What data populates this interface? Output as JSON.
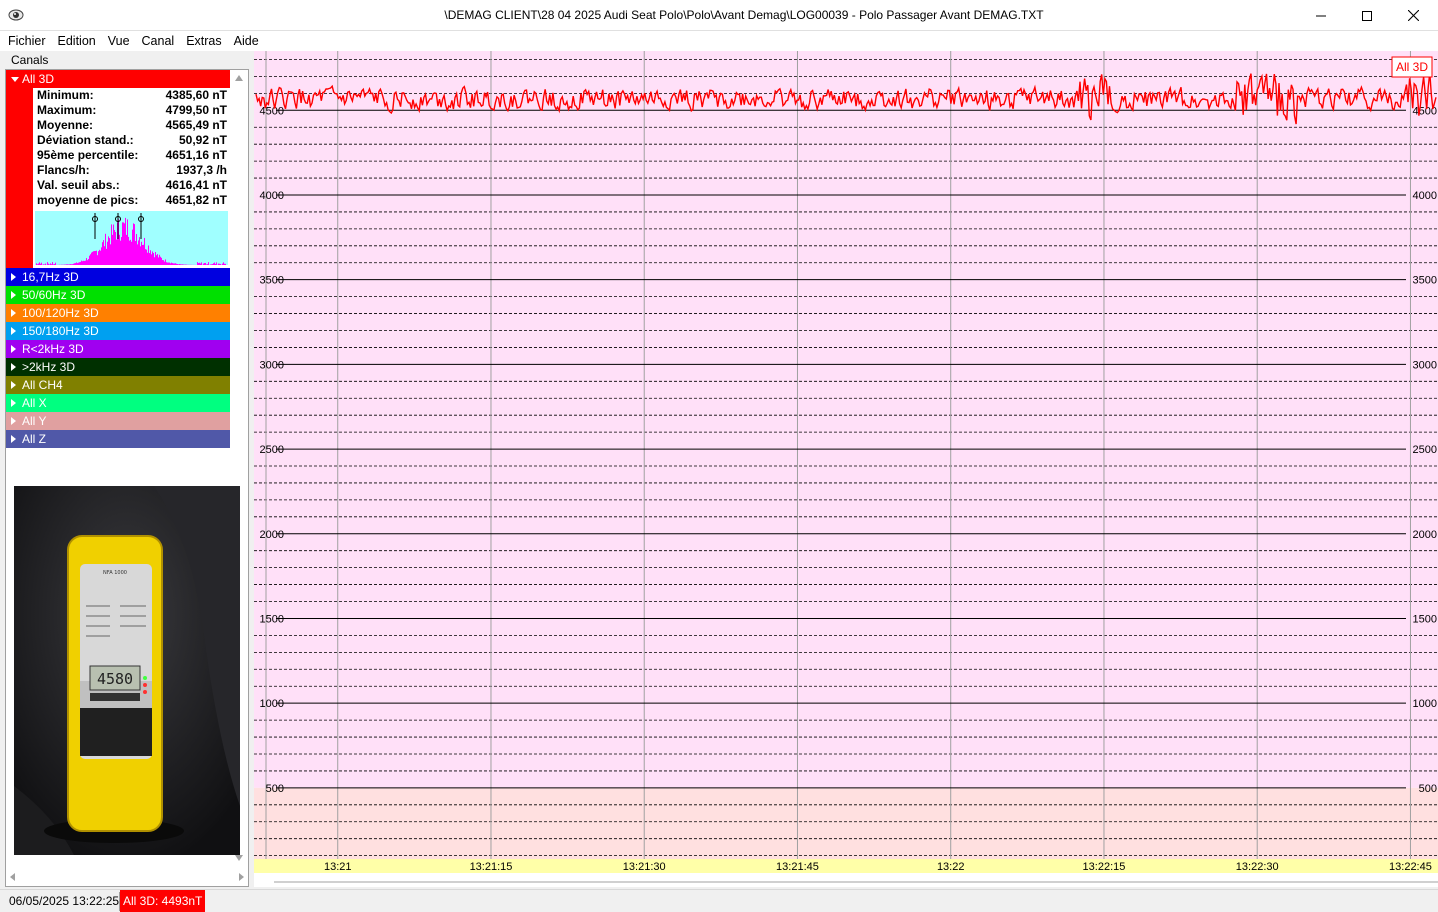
{
  "window": {
    "title": "\\DEMAG CLIENT\\28 04 2025 Audi Seat Polo\\Polo\\Avant Demag\\LOG00039 - Polo Passager Avant DEMAG.TXT"
  },
  "menu": {
    "items": [
      "Fichier",
      "Edition",
      "Vue",
      "Canal",
      "Extras",
      "Aide"
    ]
  },
  "panel": {
    "header": "Canals",
    "expanded_channel": {
      "label": "All 3D",
      "color": "#ff0000",
      "stats": [
        {
          "label": "Minimum:",
          "value": "4385,60 nT"
        },
        {
          "label": "Maximum:",
          "value": "4799,50 nT"
        },
        {
          "label": "Moyenne:",
          "value": "4565,49 nT"
        },
        {
          "label": "Déviation stand.:",
          "value": "50,92 nT"
        },
        {
          "label": "95ème percentile:",
          "value": "4651,16 nT"
        },
        {
          "label": "Flancs/h:",
          "value": "1937,3 /h"
        },
        {
          "label": "Val. seuil abs.:",
          "value": "4616,41 nT"
        },
        {
          "label": "moyenne de pics:",
          "value": "4651,82 nT"
        }
      ]
    },
    "channels": [
      {
        "label": "16,7Hz 3D",
        "color": "#0000e0"
      },
      {
        "label": "50/60Hz 3D",
        "color": "#00e000"
      },
      {
        "label": "100/120Hz 3D",
        "color": "#ff8000"
      },
      {
        "label": "150/180Hz 3D",
        "color": "#00a0f0"
      },
      {
        "label": "R<2kHz 3D",
        "color": "#a000f0"
      },
      {
        "label": ">2kHz 3D",
        "color": "#003000"
      },
      {
        "label": "All CH4",
        "color": "#808000"
      },
      {
        "label": "All X",
        "color": "#00ff80"
      },
      {
        "label": "All Y",
        "color": "#e0a0a0"
      },
      {
        "label": "All Z",
        "color": "#5058a8"
      }
    ]
  },
  "chart_data": {
    "type": "line",
    "series": [
      {
        "name": "All 3D",
        "color": "#ff0000"
      }
    ],
    "legend": "All 3D",
    "legend_position": "top-right",
    "y_tick_labels": [
      "4500",
      "4000",
      "3500",
      "3000",
      "2500",
      "2000",
      "1500",
      "1000",
      "500"
    ],
    "y_ticks": [
      4500,
      4000,
      3500,
      3000,
      2500,
      2000,
      1500,
      1000,
      500
    ],
    "ylim": [
      80,
      4850
    ],
    "x_tick_labels": [
      "13:21",
      "13:21:15",
      "13:21:30",
      "13:21:45",
      "13:22",
      "13:22:15",
      "13:22:30",
      "13:22:45"
    ],
    "x_ticks_seconds": [
      60,
      75,
      90,
      105,
      120,
      135,
      150,
      165
    ],
    "xlim_seconds": [
      52,
      167.5
    ],
    "grid": true,
    "minor_step": 100,
    "bands": [
      {
        "from": 500,
        "to": 4850,
        "color": "#ffe0f8"
      },
      {
        "from": 80,
        "to": 500,
        "color": "#ffe0e0"
      }
    ],
    "x_axis_strip_color": "#ffffa8",
    "min": 4385.6,
    "max": 4799.5,
    "mean": 4565.49,
    "std": 50.92
  },
  "status": {
    "datetime": "06/05/2025 13:22:25",
    "current_value": "All 3D: 4493nT"
  }
}
